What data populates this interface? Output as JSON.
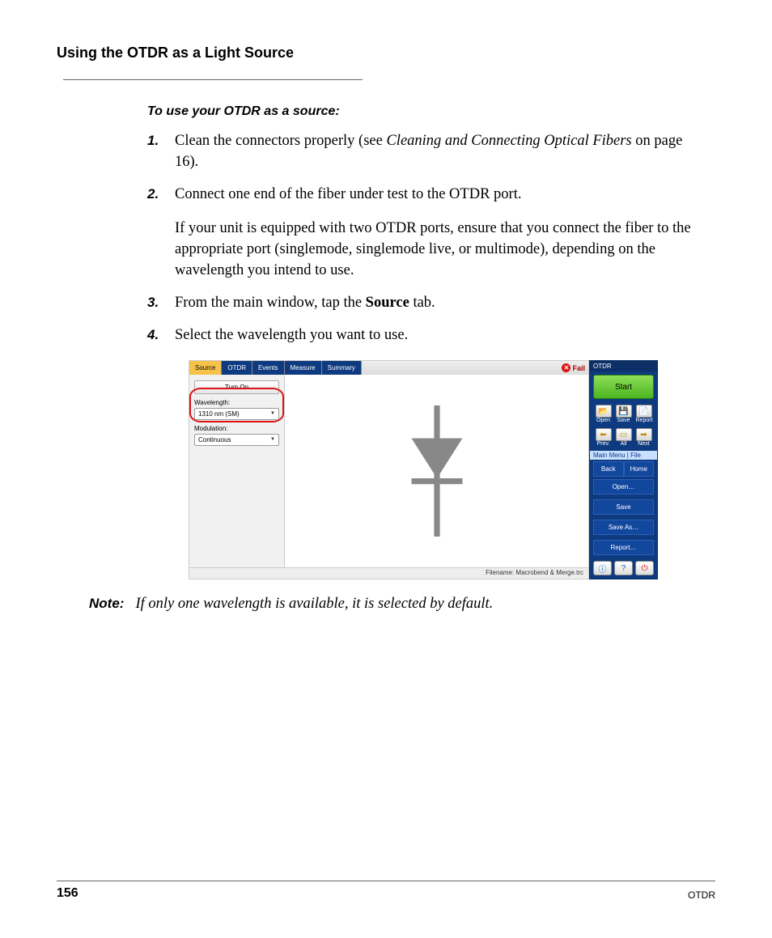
{
  "header": "Using the OTDR as a Light Source",
  "subhead": "To use your OTDR as a source:",
  "steps": {
    "s1a": "Clean the connectors properly (see ",
    "s1em": "Cleaning and Connecting Optical Fibers",
    "s1b": " on page 16).",
    "s2": "Connect one end of the fiber under test to the OTDR port.",
    "s2x": "If your unit is equipped with two OTDR ports, ensure that you connect the fiber to the appropriate port (singlemode, singlemode live, or multimode), depending on the wavelength you intend to use.",
    "s3a": "From the main window, tap the ",
    "s3s": "Source",
    "s3b": " tab.",
    "s4": "Select the wavelength you want to use."
  },
  "ss": {
    "tabs": {
      "source": "Source",
      "otdr": "OTDR",
      "events": "Events",
      "measure": "Measure",
      "summary": "Summary"
    },
    "fail": "Fail",
    "panel": {
      "turnon": "Turn On",
      "wavelength_lbl": "Wavelength:",
      "wavelength_val": "1310 nm (SM)",
      "modulation_lbl": "Modulation:",
      "modulation_val": "Continuous"
    },
    "footer": "Filename: Macrobend & Merge.trc",
    "side": {
      "title": "OTDR",
      "start": "Start",
      "open": "Open",
      "save": "Save",
      "report": "Report",
      "prev": "Prev.",
      "all": "All",
      "next": "Next",
      "bar": "Main Menu | File",
      "back": "Back",
      "home": "Home",
      "openm": "Open…",
      "savem": "Save",
      "saveas": "Save As…",
      "reportm": "Report…"
    }
  },
  "note": {
    "label": "Note:",
    "text": "If only one wavelength is available, it is selected by default."
  },
  "footer": {
    "page": "156",
    "doc": "OTDR"
  }
}
